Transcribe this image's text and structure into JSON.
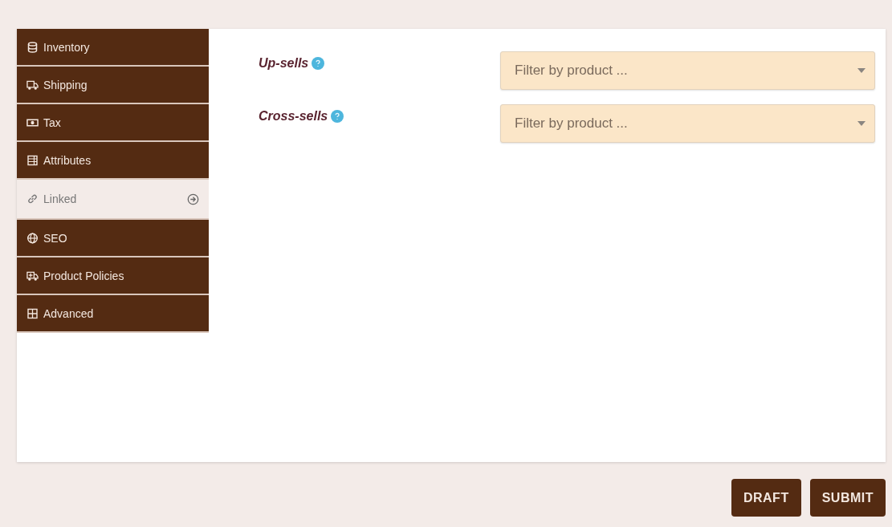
{
  "sidebar": {
    "items": [
      {
        "label": "Inventory",
        "selected": false
      },
      {
        "label": "Shipping",
        "selected": false
      },
      {
        "label": "Tax",
        "selected": false
      },
      {
        "label": "Attributes",
        "selected": false
      },
      {
        "label": "Linked",
        "selected": true
      },
      {
        "label": "SEO",
        "selected": false
      },
      {
        "label": "Product Policies",
        "selected": false
      },
      {
        "label": "Advanced",
        "selected": false
      }
    ]
  },
  "fields": [
    {
      "label": "Up-sells",
      "placeholder": "Filter by product ..."
    },
    {
      "label": "Cross-sells",
      "placeholder": "Filter by product ..."
    }
  ],
  "buttons": [
    "DRAFT",
    "SUBMIT"
  ]
}
